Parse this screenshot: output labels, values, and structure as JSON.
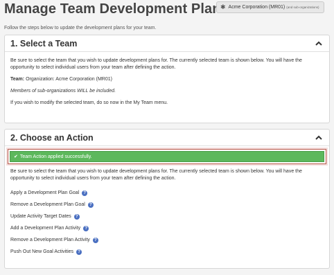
{
  "header": {
    "title": "Manage Team Development Plans",
    "org_badge": {
      "icon": "asterisk-icon",
      "label": "Acme Corporation (MR01)",
      "sub_label": "(and sub-organizations)"
    }
  },
  "intro": "Follow the steps below to update the development plans for your team.",
  "step1": {
    "title": "1. Select a Team",
    "description": "Be sure to select the team that you wish to update development plans for. The currently selected team is shown below. You will have the opportunity to select individual users from your team after defining the action.",
    "team_label": "Team:",
    "team_value": "Organization: Acme Corporation (MR01)",
    "sub_org_note": "Members of sub-organizations WILL be included.",
    "modify_note": "If you wish to modify the selected team, do so now in the My Team menu."
  },
  "step2": {
    "title": "2. Choose an Action",
    "alert": "Team Action applied successfully.",
    "description": "Be sure to select the team that you wish to update development plans for. The currently selected team is shown below. You will have the opportunity to select individual users from your team after defining the action.",
    "actions": [
      {
        "label": "Apply a Development Plan Goal"
      },
      {
        "label": "Remove a Development Plan Goal"
      },
      {
        "label": "Update Activity Target Dates"
      },
      {
        "label": "Add a Development Plan Activity"
      },
      {
        "label": "Remove a Development Plan Activity"
      },
      {
        "label": "Push Out New Goal Activities"
      }
    ]
  },
  "colors": {
    "success": "#5cb85c",
    "help_icon": "#4a6fc1",
    "alert_border": "#b85a4a"
  }
}
